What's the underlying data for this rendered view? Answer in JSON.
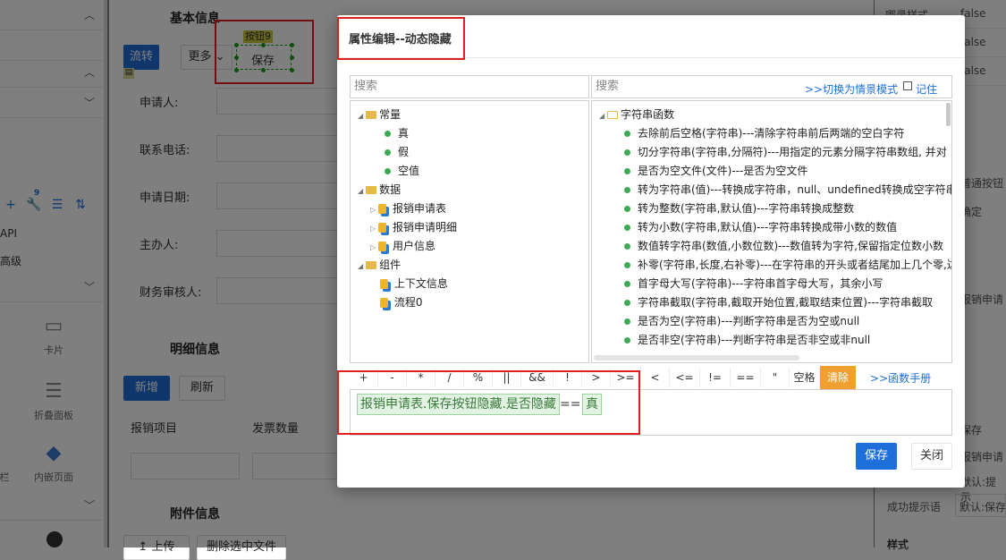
{
  "left": {
    "api": "API",
    "advanced": "高级",
    "widgets": [
      {
        "label": "卡片",
        "icon": "card-icon"
      },
      {
        "label": "折叠面板",
        "icon": "collapse-icon"
      },
      {
        "label": "内嵌页面",
        "icon": "embed-page-icon"
      },
      {
        "label": "栏",
        "icon": "column-icon"
      }
    ],
    "toolbar_badge": "9"
  },
  "form": {
    "section_basic": "基本信息",
    "section_detail": "明细信息",
    "section_attach": "附件信息",
    "btn_flow": "流转",
    "btn_more": "更多",
    "btn_save": "保存",
    "tag_button": "按钮9",
    "fields": [
      "申请人:",
      "联系电话:",
      "申请日期:",
      "主办人:",
      "财务审核人:"
    ],
    "btn_add": "新增",
    "btn_refresh": "刷新",
    "col_item": "报销项目",
    "col_count": "发票数量",
    "btn_upload": "上传",
    "btn_delete_files": "删除选中文件"
  },
  "right": {
    "rows": [
      {
        "k": "哪录样式",
        "v": "false"
      },
      {
        "k": "",
        "v": "false"
      },
      {
        "k": "",
        "v": "false"
      }
    ],
    "side_texts": [
      "普通按钮",
      "确定",
      "报销申请",
      "保存",
      "报销申请",
      "默认:提示",
      "默认:保存"
    ],
    "success_label": "成功提示语",
    "success_value": "默认:保存",
    "style_label": "样式"
  },
  "modal": {
    "title": "属性编辑--动态隐藏",
    "search_left": "搜索",
    "search_right": "搜索",
    "switch_mode": ">>切换为情景模式",
    "remember": "记住",
    "tree": {
      "const_group": "常量",
      "const_items": [
        "真",
        "假",
        "空值"
      ],
      "data_group": "数据",
      "data_items": [
        "报销申请表",
        "报销申请明细",
        "用户信息"
      ],
      "comp_group": "组件",
      "comp_items": [
        "上下文信息",
        "流程0"
      ]
    },
    "func_group": "字符串函数",
    "functions": [
      "去除前后空格(字符串)---清除字符串前后两端的空白字符",
      "切分字符串(字符串,分隔符)---用指定的元素分隔字符串数组, 并对",
      "是否为空文件(文件)---是否为空文件",
      "转为字符串(值)---转换成字符串，null、undefined转换成空字符串",
      "转为整数(字符串,默认值)---字符串转换成整数",
      "转为小数(字符串,默认值)---字符串转换成带小数的数值",
      "数值转字符串(数值,小数位数)---数值转为字符,保留指定位数小数",
      "补零(字符串,长度,右补零)---在字符串的开头或者结尾加上几个零,达",
      "首字母大写(字符串)---字符串首字母大写，其余小写",
      "字符串截取(字符串,截取开始位置,截取结束位置)---字符串截取",
      "是否为空(字符串)---判断字符串是否为空或null",
      "是否非空(字符串)---判断字符串是否非空或非null"
    ],
    "operators": [
      "+",
      "-",
      "*",
      "/",
      "%",
      "||",
      "&&",
      "!",
      ">",
      ">=",
      "<",
      "<=",
      "!=",
      "==",
      "\"",
      "空格"
    ],
    "clear": "清除",
    "manual": ">>函数手册",
    "expr_field": "报销申请表.保存按钮隐藏.是否隐藏",
    "expr_op": "==",
    "expr_value": "真",
    "btn_save": "保存",
    "btn_close": "关闭"
  }
}
